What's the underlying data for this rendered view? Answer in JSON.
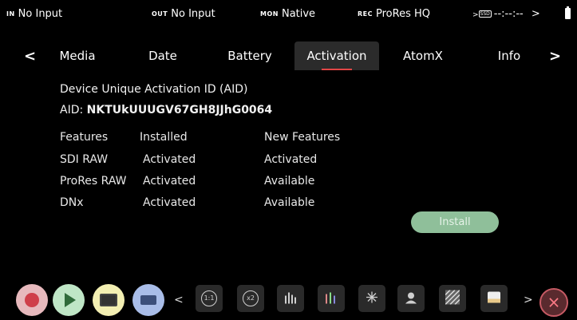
{
  "status": {
    "in_label": "IN",
    "in_value": "No Input",
    "out_label": "OUT",
    "out_value": "No Input",
    "mon_label": "MON",
    "mon_value": "Native",
    "rec_label": "REC",
    "rec_value": "ProRes HQ",
    "ssd_label": "SSD",
    "timecode": "--:--:--"
  },
  "tabs": [
    {
      "label": "Media"
    },
    {
      "label": "Date"
    },
    {
      "label": "Battery"
    },
    {
      "label": "Activation"
    },
    {
      "label": "AtomX"
    },
    {
      "label": "Info"
    }
  ],
  "activation": {
    "heading": "Device Unique Activation ID (AID)",
    "aid_label": "AID:",
    "aid_value": "NKTUkUUUGV67GH8JJhG0064",
    "headers": [
      "Features",
      "Installed",
      "New Features"
    ],
    "rows": [
      {
        "feature": "SDI RAW",
        "installed": "Activated",
        "new": "Activated"
      },
      {
        "feature": "ProRes RAW",
        "installed": "Activated",
        "new": "Available"
      },
      {
        "feature": "DNx",
        "installed": "Activated",
        "new": "Available"
      }
    ],
    "install_button": "Install"
  },
  "toolbar": {
    "zoom1": "1:1",
    "zoom2": "x2"
  }
}
